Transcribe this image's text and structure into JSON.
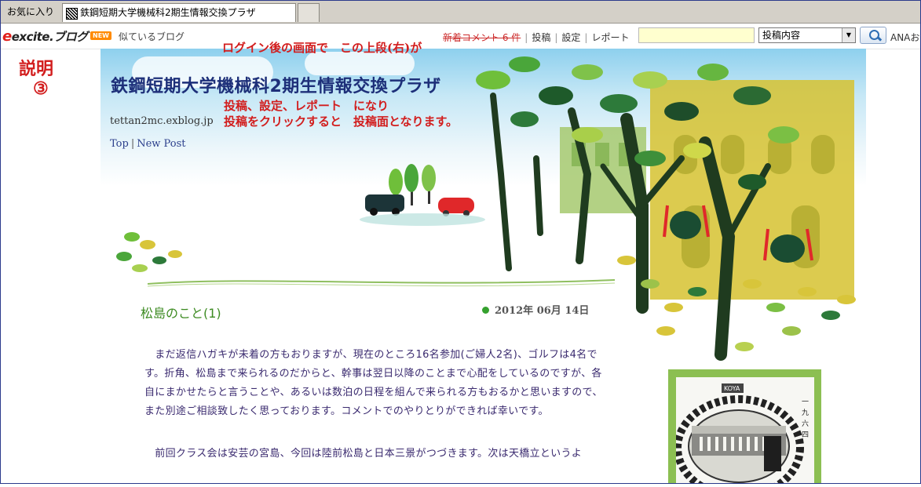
{
  "tabs": {
    "favorites": "お気に入り",
    "active": "鉄鋼短期大学機械科2期生情報交換プラザ"
  },
  "header": {
    "logo": "excite.ブログ",
    "new_badge": "NEW",
    "similar": "似ているブログ",
    "links": [
      "新着コメント 6 件",
      "投稿",
      "設定",
      "レポート"
    ],
    "search_placeholder": "",
    "search_scope": "投稿内容",
    "ana": "ANAお"
  },
  "annotations": {
    "setsumei": "説明",
    "number": "③",
    "top_note": "ログイン後の画面で　この上段(右)が",
    "mid_note1": "投稿、設定、レポート　になり",
    "mid_note2": "投稿をクリックすると　投稿面となります。"
  },
  "blog": {
    "title": "鉄鋼短期大学機械科2期生情報交換プラザ",
    "url": "tettan2mc.exblog.jp",
    "nav_top": "Top",
    "nav_new": "New Post"
  },
  "post": {
    "title": "松島のこと(1)",
    "date": "2012年 06月 14日",
    "para1": "　まだ返信ハガキが未着の方もおりますが、現在のところ16名参加(ご婦人2名)、ゴルフは4名です。折角、松島まで来られるのだからと、幹事は翌日以降のことまで心配をしているのですが、各自にまかせたらと言うことや、あるいは数泊の日程を組んで来られる方もおるかと思いますので、また別途ご相談致したく思っております。コメントでのやりとりができれば幸いです。",
    "para2": "　前回クラス会は安芸の宮島、今回は陸前松島と日本三景がつづきます。次は天橋立というよ"
  },
  "photo": {
    "sign": "KOYA",
    "vertical": "一九六四"
  },
  "colors": {
    "annotation_red": "#d21d1d",
    "title_blue": "#1d2f79",
    "post_green": "#3d8b22",
    "body_purple": "#3a2a6f",
    "frame_green": "#8cbf52"
  }
}
